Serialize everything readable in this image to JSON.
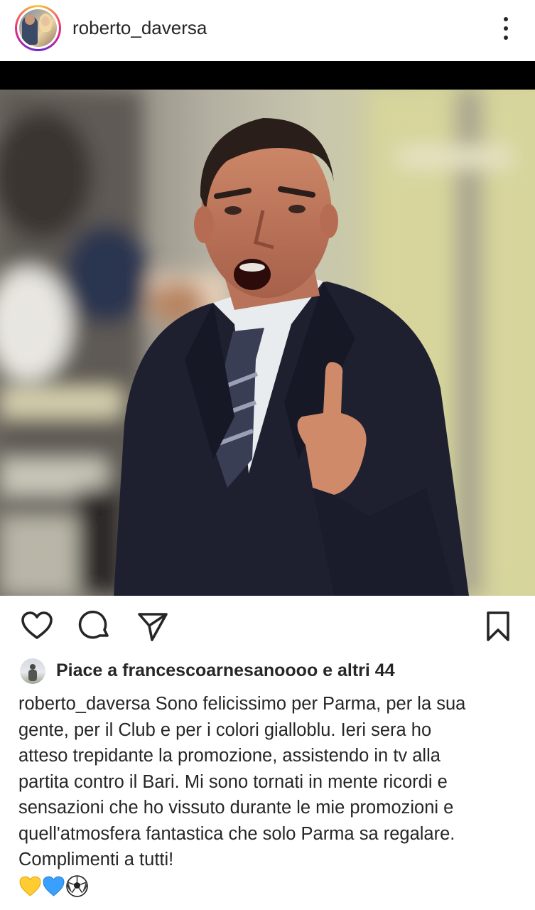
{
  "header": {
    "username": "roberto_daversa",
    "avatar_icon": "profile-avatar",
    "more_icon": "more-vertical-icon"
  },
  "post": {
    "image_alt": "man in dark suit gesturing at stadium"
  },
  "actions": {
    "like_icon": "heart-icon",
    "comment_icon": "comment-icon",
    "share_icon": "send-icon",
    "save_icon": "bookmark-icon"
  },
  "likes": {
    "text": "Piace a francescoarnesanoooo e altri 44"
  },
  "caption": {
    "username": "roberto_daversa",
    "lines": [
      "Sono felicissimo per Parma, per la sua",
      "gente, per il Club e per i colori gialloblu. Ieri sera ho",
      "atteso trepidante la promozione, assistendo in tv alla",
      "partita contro il Bari. Mi sono tornati in mente ricordi e",
      "sensazioni che ho vissuto durante le mie promozioni e",
      "quell'atmosfera fantastica che solo Parma sa regalare.",
      "Complimenti a tutti!"
    ],
    "emojis": [
      "yellow-heart",
      "blue-heart",
      "soccer-ball"
    ]
  },
  "colors": {
    "text": "#262626",
    "background": "#ffffff",
    "yellow_heart": "#ffcc33",
    "blue_heart": "#3aa0ff"
  }
}
